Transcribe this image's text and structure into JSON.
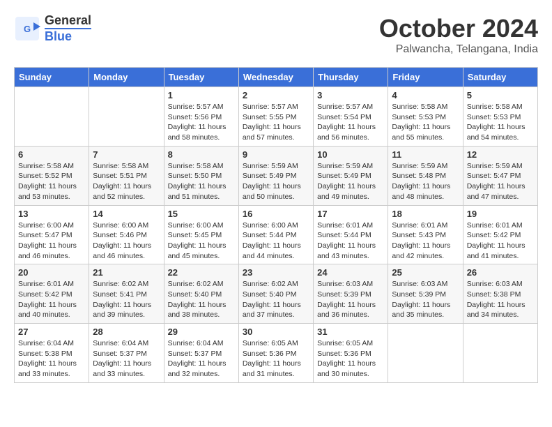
{
  "logo": {
    "line1": "General",
    "line2": "Blue"
  },
  "title": "October 2024",
  "subtitle": "Palwancha, Telangana, India",
  "days_of_week": [
    "Sunday",
    "Monday",
    "Tuesday",
    "Wednesday",
    "Thursday",
    "Friday",
    "Saturday"
  ],
  "weeks": [
    [
      {
        "day": "",
        "info": ""
      },
      {
        "day": "",
        "info": ""
      },
      {
        "day": "1",
        "sunrise": "5:57 AM",
        "sunset": "5:56 PM",
        "daylight": "11 hours and 58 minutes."
      },
      {
        "day": "2",
        "sunrise": "5:57 AM",
        "sunset": "5:55 PM",
        "daylight": "11 hours and 57 minutes."
      },
      {
        "day": "3",
        "sunrise": "5:57 AM",
        "sunset": "5:54 PM",
        "daylight": "11 hours and 56 minutes."
      },
      {
        "day": "4",
        "sunrise": "5:58 AM",
        "sunset": "5:53 PM",
        "daylight": "11 hours and 55 minutes."
      },
      {
        "day": "5",
        "sunrise": "5:58 AM",
        "sunset": "5:53 PM",
        "daylight": "11 hours and 54 minutes."
      }
    ],
    [
      {
        "day": "6",
        "sunrise": "5:58 AM",
        "sunset": "5:52 PM",
        "daylight": "11 hours and 53 minutes."
      },
      {
        "day": "7",
        "sunrise": "5:58 AM",
        "sunset": "5:51 PM",
        "daylight": "11 hours and 52 minutes."
      },
      {
        "day": "8",
        "sunrise": "5:58 AM",
        "sunset": "5:50 PM",
        "daylight": "11 hours and 51 minutes."
      },
      {
        "day": "9",
        "sunrise": "5:59 AM",
        "sunset": "5:49 PM",
        "daylight": "11 hours and 50 minutes."
      },
      {
        "day": "10",
        "sunrise": "5:59 AM",
        "sunset": "5:49 PM",
        "daylight": "11 hours and 49 minutes."
      },
      {
        "day": "11",
        "sunrise": "5:59 AM",
        "sunset": "5:48 PM",
        "daylight": "11 hours and 48 minutes."
      },
      {
        "day": "12",
        "sunrise": "5:59 AM",
        "sunset": "5:47 PM",
        "daylight": "11 hours and 47 minutes."
      }
    ],
    [
      {
        "day": "13",
        "sunrise": "6:00 AM",
        "sunset": "5:47 PM",
        "daylight": "11 hours and 46 minutes."
      },
      {
        "day": "14",
        "sunrise": "6:00 AM",
        "sunset": "5:46 PM",
        "daylight": "11 hours and 46 minutes."
      },
      {
        "day": "15",
        "sunrise": "6:00 AM",
        "sunset": "5:45 PM",
        "daylight": "11 hours and 45 minutes."
      },
      {
        "day": "16",
        "sunrise": "6:00 AM",
        "sunset": "5:44 PM",
        "daylight": "11 hours and 44 minutes."
      },
      {
        "day": "17",
        "sunrise": "6:01 AM",
        "sunset": "5:44 PM",
        "daylight": "11 hours and 43 minutes."
      },
      {
        "day": "18",
        "sunrise": "6:01 AM",
        "sunset": "5:43 PM",
        "daylight": "11 hours and 42 minutes."
      },
      {
        "day": "19",
        "sunrise": "6:01 AM",
        "sunset": "5:42 PM",
        "daylight": "11 hours and 41 minutes."
      }
    ],
    [
      {
        "day": "20",
        "sunrise": "6:01 AM",
        "sunset": "5:42 PM",
        "daylight": "11 hours and 40 minutes."
      },
      {
        "day": "21",
        "sunrise": "6:02 AM",
        "sunset": "5:41 PM",
        "daylight": "11 hours and 39 minutes."
      },
      {
        "day": "22",
        "sunrise": "6:02 AM",
        "sunset": "5:40 PM",
        "daylight": "11 hours and 38 minutes."
      },
      {
        "day": "23",
        "sunrise": "6:02 AM",
        "sunset": "5:40 PM",
        "daylight": "11 hours and 37 minutes."
      },
      {
        "day": "24",
        "sunrise": "6:03 AM",
        "sunset": "5:39 PM",
        "daylight": "11 hours and 36 minutes."
      },
      {
        "day": "25",
        "sunrise": "6:03 AM",
        "sunset": "5:39 PM",
        "daylight": "11 hours and 35 minutes."
      },
      {
        "day": "26",
        "sunrise": "6:03 AM",
        "sunset": "5:38 PM",
        "daylight": "11 hours and 34 minutes."
      }
    ],
    [
      {
        "day": "27",
        "sunrise": "6:04 AM",
        "sunset": "5:38 PM",
        "daylight": "11 hours and 33 minutes."
      },
      {
        "day": "28",
        "sunrise": "6:04 AM",
        "sunset": "5:37 PM",
        "daylight": "11 hours and 33 minutes."
      },
      {
        "day": "29",
        "sunrise": "6:04 AM",
        "sunset": "5:37 PM",
        "daylight": "11 hours and 32 minutes."
      },
      {
        "day": "30",
        "sunrise": "6:05 AM",
        "sunset": "5:36 PM",
        "daylight": "11 hours and 31 minutes."
      },
      {
        "day": "31",
        "sunrise": "6:05 AM",
        "sunset": "5:36 PM",
        "daylight": "11 hours and 30 minutes."
      },
      {
        "day": "",
        "info": ""
      },
      {
        "day": "",
        "info": ""
      }
    ]
  ],
  "labels": {
    "sunrise": "Sunrise:",
    "sunset": "Sunset:",
    "daylight": "Daylight: 11 hours"
  }
}
